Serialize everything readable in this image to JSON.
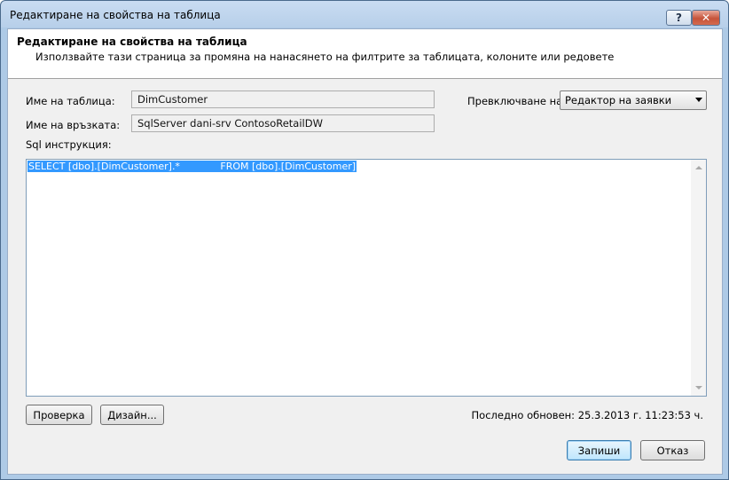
{
  "window": {
    "title": "Редактиране на свойства на таблица",
    "help_label": "?",
    "close_label": "✕"
  },
  "header": {
    "title": "Редактиране на свойства на таблица",
    "subtitle": "Използвайте тази страница за промяна на нанасянето на филтрите за таблицата, колоните или редовете"
  },
  "form": {
    "table_name_label": "Име на таблица:",
    "table_name_value": "DimCustomer",
    "connection_label": "Име на връзката:",
    "connection_value": "SqlServer dani-srv ContosoRetailDW",
    "switch_label": "Превключване на:",
    "switch_value": "Редактор на заявки",
    "sql_label": "Sql инструкция:",
    "sql_text": "SELECT [dbo].[DimCustomer].*             FROM [dbo].[DimCustomer]"
  },
  "buttons": {
    "validate": "Проверка",
    "design": "Дизайн...",
    "save": "Запиши",
    "cancel": "Отказ"
  },
  "status": {
    "last_updated": "Последно обновен: 25.3.2013 г. 11:23:53 ч."
  }
}
